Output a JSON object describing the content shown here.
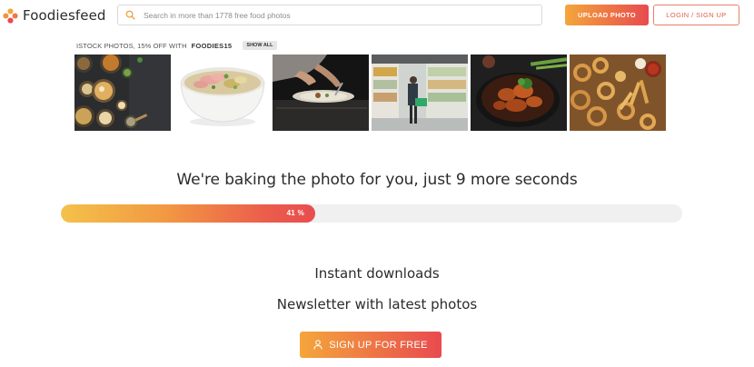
{
  "header": {
    "logo_text": "Foodiesfeed",
    "search_placeholder": "Search in more than 1778 free food photos",
    "upload_label": "UPLOAD PHOTO",
    "login_label": "LOGIN / SIGN UP"
  },
  "promo": {
    "text": "ISTOCK PHOTOS, 15% OFF WITH",
    "code": "FOODIES15",
    "show_all_label": "SHOW ALL"
  },
  "photos": [
    {
      "subject": "table spread of dishes"
    },
    {
      "subject": "bowl of pho soup"
    },
    {
      "subject": "chef plating in kitchen"
    },
    {
      "subject": "shopper at refrigerated aisle"
    },
    {
      "subject": "braised meat in pan"
    },
    {
      "subject": "onion rings and fries"
    }
  ],
  "baking": {
    "title": "We're baking the photo for you, just 9 more seconds",
    "progress_percent": 41,
    "progress_label": "41 %"
  },
  "features": {
    "line_1": "Instant downloads",
    "line_2": "Newsletter with latest photos"
  },
  "cta": {
    "signup_label": "SIGN UP FOR FREE"
  },
  "colors": {
    "accent_start": "#f4a63b",
    "accent_end": "#e84a4f",
    "login_border": "#e97e6a",
    "progress_track": "#f0f0f0"
  },
  "icons": {
    "logo": "foodiesfeed-flower-icon",
    "search": "search-icon",
    "signup": "user-icon"
  }
}
